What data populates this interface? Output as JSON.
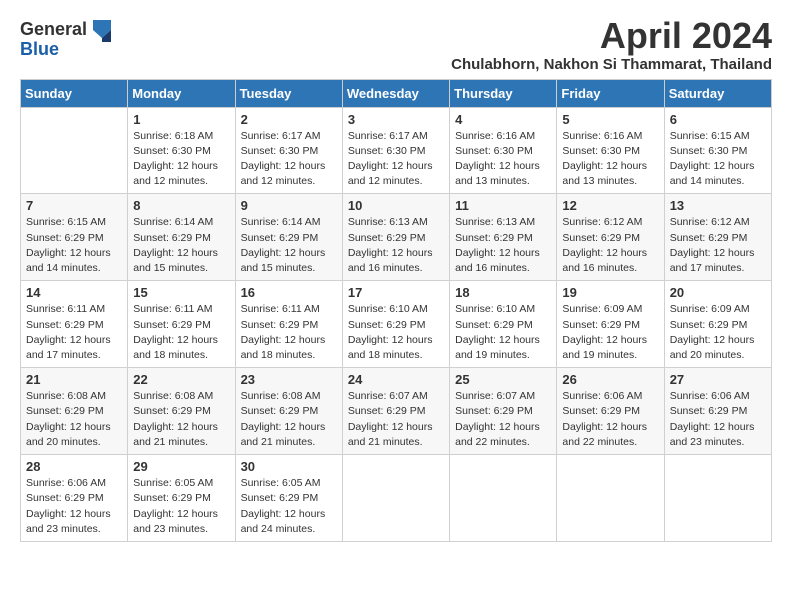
{
  "logo": {
    "general": "General",
    "blue": "Blue"
  },
  "title": "April 2024",
  "subtitle": "Chulabhorn, Nakhon Si Thammarat, Thailand",
  "days_of_week": [
    "Sunday",
    "Monday",
    "Tuesday",
    "Wednesday",
    "Thursday",
    "Friday",
    "Saturday"
  ],
  "weeks": [
    [
      {
        "day": "",
        "info": ""
      },
      {
        "day": "1",
        "info": "Sunrise: 6:18 AM\nSunset: 6:30 PM\nDaylight: 12 hours\nand 12 minutes."
      },
      {
        "day": "2",
        "info": "Sunrise: 6:17 AM\nSunset: 6:30 PM\nDaylight: 12 hours\nand 12 minutes."
      },
      {
        "day": "3",
        "info": "Sunrise: 6:17 AM\nSunset: 6:30 PM\nDaylight: 12 hours\nand 12 minutes."
      },
      {
        "day": "4",
        "info": "Sunrise: 6:16 AM\nSunset: 6:30 PM\nDaylight: 12 hours\nand 13 minutes."
      },
      {
        "day": "5",
        "info": "Sunrise: 6:16 AM\nSunset: 6:30 PM\nDaylight: 12 hours\nand 13 minutes."
      },
      {
        "day": "6",
        "info": "Sunrise: 6:15 AM\nSunset: 6:30 PM\nDaylight: 12 hours\nand 14 minutes."
      }
    ],
    [
      {
        "day": "7",
        "info": "Sunrise: 6:15 AM\nSunset: 6:29 PM\nDaylight: 12 hours\nand 14 minutes."
      },
      {
        "day": "8",
        "info": "Sunrise: 6:14 AM\nSunset: 6:29 PM\nDaylight: 12 hours\nand 15 minutes."
      },
      {
        "day": "9",
        "info": "Sunrise: 6:14 AM\nSunset: 6:29 PM\nDaylight: 12 hours\nand 15 minutes."
      },
      {
        "day": "10",
        "info": "Sunrise: 6:13 AM\nSunset: 6:29 PM\nDaylight: 12 hours\nand 16 minutes."
      },
      {
        "day": "11",
        "info": "Sunrise: 6:13 AM\nSunset: 6:29 PM\nDaylight: 12 hours\nand 16 minutes."
      },
      {
        "day": "12",
        "info": "Sunrise: 6:12 AM\nSunset: 6:29 PM\nDaylight: 12 hours\nand 16 minutes."
      },
      {
        "day": "13",
        "info": "Sunrise: 6:12 AM\nSunset: 6:29 PM\nDaylight: 12 hours\nand 17 minutes."
      }
    ],
    [
      {
        "day": "14",
        "info": "Sunrise: 6:11 AM\nSunset: 6:29 PM\nDaylight: 12 hours\nand 17 minutes."
      },
      {
        "day": "15",
        "info": "Sunrise: 6:11 AM\nSunset: 6:29 PM\nDaylight: 12 hours\nand 18 minutes."
      },
      {
        "day": "16",
        "info": "Sunrise: 6:11 AM\nSunset: 6:29 PM\nDaylight: 12 hours\nand 18 minutes."
      },
      {
        "day": "17",
        "info": "Sunrise: 6:10 AM\nSunset: 6:29 PM\nDaylight: 12 hours\nand 18 minutes."
      },
      {
        "day": "18",
        "info": "Sunrise: 6:10 AM\nSunset: 6:29 PM\nDaylight: 12 hours\nand 19 minutes."
      },
      {
        "day": "19",
        "info": "Sunrise: 6:09 AM\nSunset: 6:29 PM\nDaylight: 12 hours\nand 19 minutes."
      },
      {
        "day": "20",
        "info": "Sunrise: 6:09 AM\nSunset: 6:29 PM\nDaylight: 12 hours\nand 20 minutes."
      }
    ],
    [
      {
        "day": "21",
        "info": "Sunrise: 6:08 AM\nSunset: 6:29 PM\nDaylight: 12 hours\nand 20 minutes."
      },
      {
        "day": "22",
        "info": "Sunrise: 6:08 AM\nSunset: 6:29 PM\nDaylight: 12 hours\nand 21 minutes."
      },
      {
        "day": "23",
        "info": "Sunrise: 6:08 AM\nSunset: 6:29 PM\nDaylight: 12 hours\nand 21 minutes."
      },
      {
        "day": "24",
        "info": "Sunrise: 6:07 AM\nSunset: 6:29 PM\nDaylight: 12 hours\nand 21 minutes."
      },
      {
        "day": "25",
        "info": "Sunrise: 6:07 AM\nSunset: 6:29 PM\nDaylight: 12 hours\nand 22 minutes."
      },
      {
        "day": "26",
        "info": "Sunrise: 6:06 AM\nSunset: 6:29 PM\nDaylight: 12 hours\nand 22 minutes."
      },
      {
        "day": "27",
        "info": "Sunrise: 6:06 AM\nSunset: 6:29 PM\nDaylight: 12 hours\nand 23 minutes."
      }
    ],
    [
      {
        "day": "28",
        "info": "Sunrise: 6:06 AM\nSunset: 6:29 PM\nDaylight: 12 hours\nand 23 minutes."
      },
      {
        "day": "29",
        "info": "Sunrise: 6:05 AM\nSunset: 6:29 PM\nDaylight: 12 hours\nand 23 minutes."
      },
      {
        "day": "30",
        "info": "Sunrise: 6:05 AM\nSunset: 6:29 PM\nDaylight: 12 hours\nand 24 minutes."
      },
      {
        "day": "",
        "info": ""
      },
      {
        "day": "",
        "info": ""
      },
      {
        "day": "",
        "info": ""
      },
      {
        "day": "",
        "info": ""
      }
    ]
  ]
}
